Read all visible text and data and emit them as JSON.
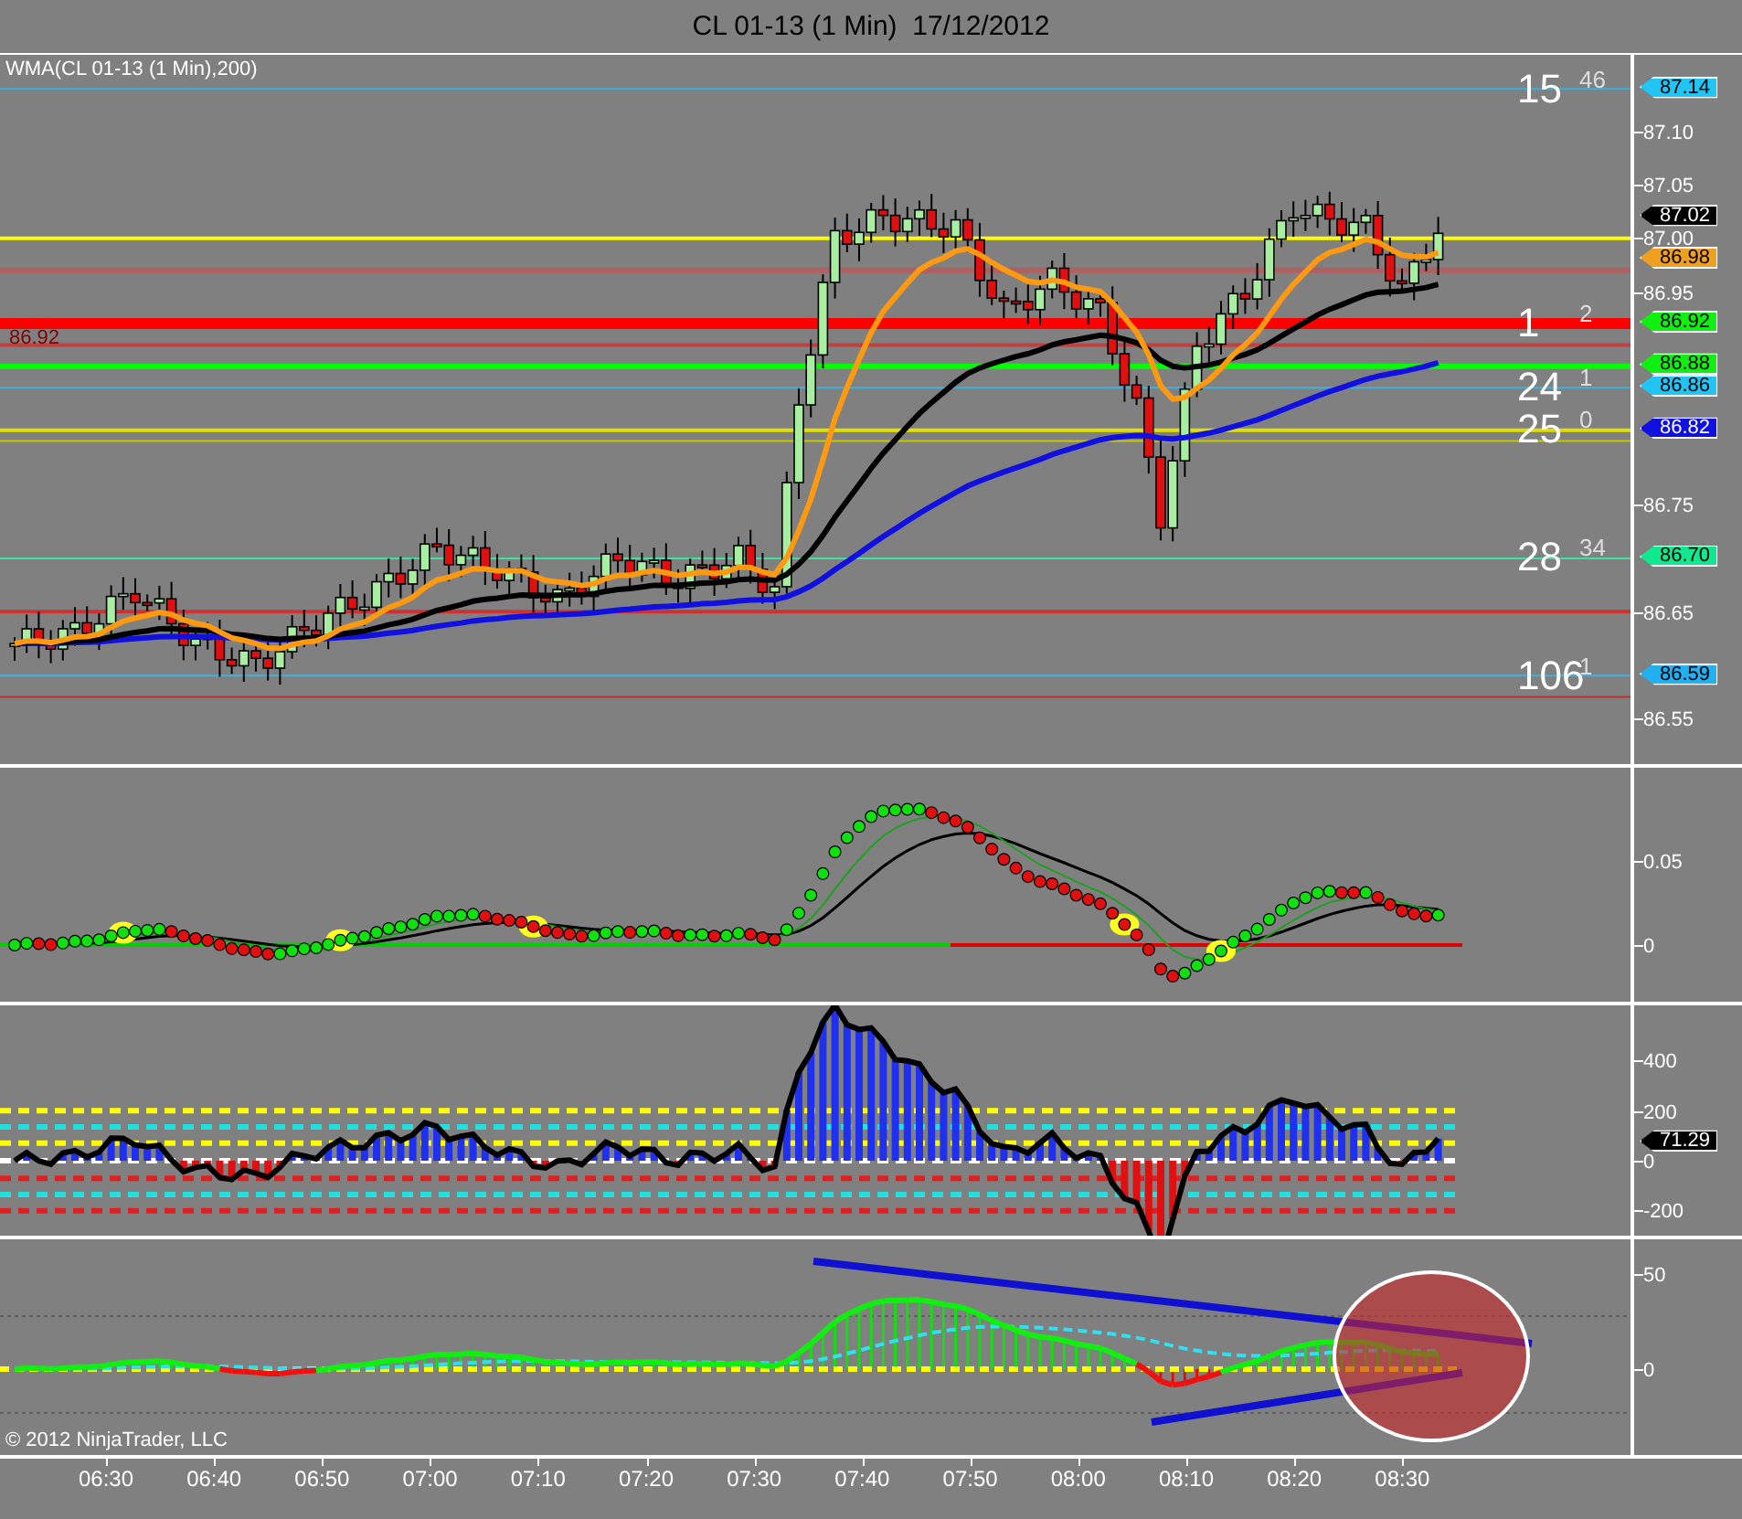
{
  "title": "CL 01-13 (1 Min)  17/12/2012",
  "panels": [
    {
      "kind": "price",
      "indicator_label": "WMA(CL 01-13 (1 Min),200)",
      "line_labels": [
        "86.92"
      ],
      "y_ticks": [
        "87.10",
        "87.05",
        "87.00",
        "86.95",
        "86.75",
        "86.65",
        "86.55"
      ],
      "price_tags": [
        {
          "price": "87.14",
          "color": "#22c4f4",
          "count": "15",
          "extra": "46"
        },
        {
          "price": "87.02",
          "color": "#000000"
        },
        {
          "price": "86.98",
          "color": "#f0a020"
        },
        {
          "price": "86.92",
          "color": "#10f010",
          "count": "1",
          "extra": "2"
        },
        {
          "price": "86.88",
          "color": "#10f010"
        },
        {
          "price": "86.86",
          "color": "#22c4f4",
          "count": "24",
          "extra": "1"
        },
        {
          "price": "86.82",
          "color": "#1010e0",
          "count": "25",
          "extra": "0"
        },
        {
          "price": "86.70",
          "color": "#10e890",
          "count": "28",
          "extra": "34"
        },
        {
          "price": "86.59",
          "color": "#22b0f0",
          "count": "106",
          "extra": "1"
        }
      ]
    },
    {
      "kind": "dots",
      "y_ticks": [
        "0.05",
        "0"
      ]
    },
    {
      "kind": "histogram",
      "y_ticks": [
        "400",
        "200",
        "0",
        "-200"
      ],
      "price_tags": [
        {
          "price": "71.29",
          "color": "#000000"
        }
      ]
    },
    {
      "kind": "momentum",
      "y_ticks": [
        "50",
        "0"
      ],
      "copyright": "© 2012 NinjaTrader, LLC"
    }
  ],
  "time_axis": [
    "06:30",
    "06:40",
    "06:50",
    "07:00",
    "07:10",
    "07:20",
    "07:30",
    "07:40",
    "07:50",
    "08:00",
    "08:10",
    "08:20",
    "08:30"
  ]
}
